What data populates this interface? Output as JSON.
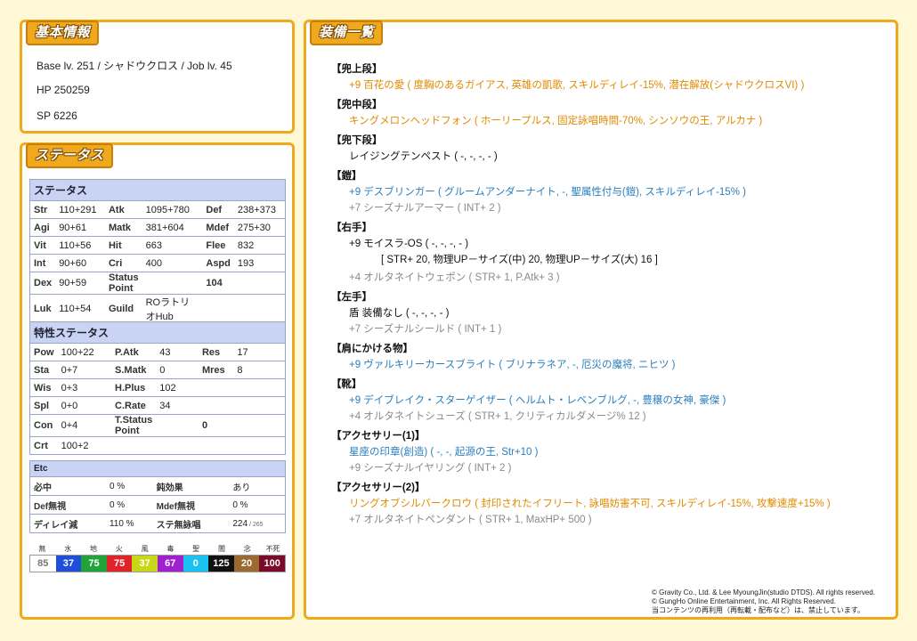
{
  "basic": {
    "title": "基本情報",
    "line1": "Base lv. 251 / シャドウクロス / Job lv. 45",
    "hp": "HP 250259",
    "sp": "SP 6226"
  },
  "status": {
    "title": "ステータス",
    "table_title": "ステータス",
    "rows": [
      [
        "Str",
        "110+291",
        "Atk",
        "1095+780",
        "Def",
        "238+373"
      ],
      [
        "Agi",
        "90+61",
        "Matk",
        "381+604",
        "Mdef",
        "275+30"
      ],
      [
        "Vit",
        "110+56",
        "Hit",
        "663",
        "Flee",
        "832"
      ],
      [
        "Int",
        "90+60",
        "Cri",
        "400",
        "Aspd",
        "193"
      ],
      [
        "Dex",
        "90+59",
        "Status Point",
        "",
        "104",
        ""
      ],
      [
        "Luk",
        "110+54",
        "Guild",
        "ROラトリオHub",
        "",
        ""
      ]
    ],
    "trait_title": "特性ステータス",
    "trait_rows": [
      [
        "Pow",
        "100+22",
        "P.Atk",
        "43",
        "Res",
        "17"
      ],
      [
        "Sta",
        "0+7",
        "S.Matk",
        "0",
        "Mres",
        "8"
      ],
      [
        "Wis",
        "0+3",
        "H.Plus",
        "102",
        "",
        ""
      ],
      [
        "Spl",
        "0+0",
        "C.Rate",
        "34",
        "",
        ""
      ],
      [
        "Con",
        "0+4",
        "T.Status Point",
        "",
        "0",
        ""
      ],
      [
        "Crt",
        "100+2",
        "",
        "",
        "",
        ""
      ]
    ],
    "etc_title": "Etc",
    "etc_rows": [
      [
        "必中",
        "0 %",
        "鈍効果",
        "あり"
      ],
      [
        "Def無視",
        "0 %",
        "Mdef無視",
        "0 %"
      ],
      [
        "ディレイ減",
        "110 %",
        "ステ無詠唱",
        "224"
      ]
    ],
    "etc_suffix": "/ 265",
    "elements": {
      "labels": [
        "無",
        "水",
        "地",
        "火",
        "風",
        "毒",
        "聖",
        "闇",
        "念",
        "不死"
      ],
      "values": [
        "85",
        "37",
        "75",
        "75",
        "37",
        "67",
        "0",
        "125",
        "20",
        "100"
      ],
      "colors": [
        "#ffffff",
        "#1f4fd8",
        "#22a33a",
        "#e0222a",
        "#c8d817",
        "#a020d0",
        "#19c2f0",
        "#111111",
        "#9a6a2e",
        "#7a0c2a"
      ],
      "text_colors": [
        "#777777",
        "#ffffff",
        "#ffffff",
        "#ffffff",
        "#ffffff",
        "#ffffff",
        "#ffffff",
        "#ffffff",
        "#ffffff",
        "#ffffff"
      ]
    }
  },
  "equip": {
    "title": "装備一覧",
    "sections": [
      {
        "label": "【兜上段】",
        "lines": [
          {
            "text": "+9 百花の愛 ( 度胸のあるガイアス, 英雄の凱歌, スキルディレイ-15%, 潜在解放(シャドウクロスVI) )",
            "color": "orange"
          }
        ]
      },
      {
        "label": "【兜中段】",
        "lines": [
          {
            "text": "キングメロンヘッドフォン ( ホーリープルス, 固定詠唱時間-70%, シンソウの王, アルカナ )",
            "color": "orange"
          }
        ]
      },
      {
        "label": "【兜下段】",
        "lines": [
          {
            "text": "レイジングテンペスト ( -, -, -, - )",
            "color": "black"
          }
        ]
      },
      {
        "label": "【鎧】",
        "lines": [
          {
            "text": "+9 デスブリンガー ( グルームアンダーナイト, -, 聖属性付与(鎧), スキルディレイ-15% )",
            "color": "blue"
          },
          {
            "text": "+7 シーズナルアーマー ( INT+ 2 )",
            "color": "gray"
          }
        ]
      },
      {
        "label": "【右手】",
        "lines": [
          {
            "text": "+9 モイスラ-OS ( -, -, -, - )",
            "color": "black"
          },
          {
            "text": "[ STR+ 20, 物理UP－サイズ(中) 20, 物理UP－サイズ(大) 16 ]",
            "color": "black",
            "indent": true
          },
          {
            "text": "+4 オルタネイトウェポン ( STR+ 1, P.Atk+ 3 )",
            "color": "gray",
            "gap": true
          }
        ]
      },
      {
        "label": "【左手】",
        "lines": [
          {
            "text": "盾 装備なし ( -, -, -, - )",
            "color": "black"
          },
          {
            "text": "+7 シーズナルシールド ( INT+ 1 )",
            "color": "gray"
          }
        ]
      },
      {
        "label": "【肩にかける物】",
        "lines": [
          {
            "text": "+9 ヴァルキリーカースブライト ( ブリナラネア, -, 厄災の魔将, ニヒツ )",
            "color": "blue"
          }
        ]
      },
      {
        "label": "【靴】",
        "lines": [
          {
            "text": "+9 デイブレイク・スターゲイザー ( ヘルムト・レベンブルグ, -, 豊穣の女神, 豪傑 )",
            "color": "blue"
          },
          {
            "text": "+4 オルタネイトシューズ ( STR+ 1, クリティカルダメージ% 12 )",
            "color": "gray"
          }
        ]
      },
      {
        "label": "【アクセサリー(1)】",
        "lines": [
          {
            "text": "星座の印章(創造) ( -, -, 起源の王, Str+10 )",
            "color": "blue"
          },
          {
            "text": "+9 シーズナルイヤリング ( INT+ 2 )",
            "color": "gray"
          }
        ]
      },
      {
        "label": "【アクセサリー(2)】",
        "lines": [
          {
            "text": "リングオブシルバークロウ ( 封印されたイフリート, 詠唱妨害不可, スキルディレイ-15%, 攻撃速度+15% )",
            "color": "orange"
          },
          {
            "text": "+7 オルタネイトペンダント ( STR+ 1, MaxHP+ 500 )",
            "color": "gray"
          }
        ]
      }
    ],
    "copyright": [
      "© Gravity Co., Ltd. & Lee MyoungJin(studio DTDS). All rights reserved.",
      "© GungHo Online Entertainment, Inc. All Rights Reserved.",
      "当コンテンツの再利用（再転載・配布など）は、禁止しています。"
    ]
  }
}
